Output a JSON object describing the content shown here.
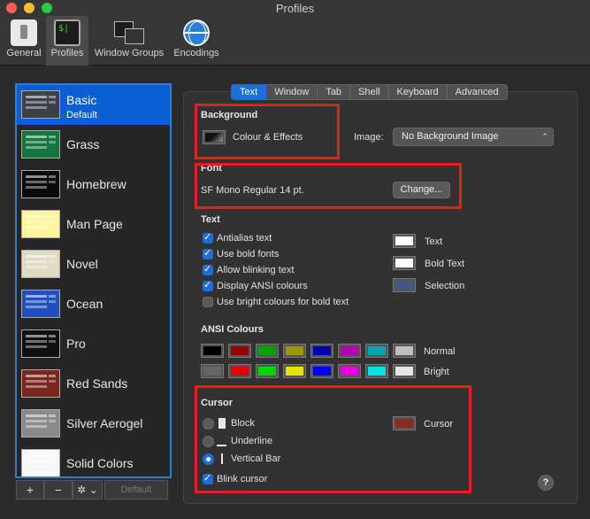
{
  "window": {
    "title": "Profiles"
  },
  "toolbar": {
    "items": [
      {
        "label": "General"
      },
      {
        "label": "Profiles"
      },
      {
        "label": "Window Groups"
      },
      {
        "label": "Encodings"
      }
    ]
  },
  "sidebar": {
    "profiles": [
      {
        "name": "Basic",
        "subtitle": "Default",
        "bg": "#3d3f4a",
        "accent": "#c8c8d0"
      },
      {
        "name": "Grass",
        "bg": "#13773d",
        "accent": "#f7f0a0"
      },
      {
        "name": "Homebrew",
        "bg": "#0a0a0a",
        "accent": "#28fe14"
      },
      {
        "name": "Man Page",
        "bg": "#fef49c",
        "accent": "#333333"
      },
      {
        "name": "Novel",
        "bg": "#dfdbc3",
        "accent": "#3b2322"
      },
      {
        "name": "Ocean",
        "bg": "#224fbc",
        "accent": "#ffffff"
      },
      {
        "name": "Pro",
        "bg": "#101010",
        "accent": "#f2f2f2"
      },
      {
        "name": "Red Sands",
        "bg": "#7a251e",
        "accent": "#d7c9a7"
      },
      {
        "name": "Silver Aerogel",
        "bg": "#8a8a8a",
        "accent": "#111111"
      },
      {
        "name": "Solid Colors",
        "bg": "#f7f7f7",
        "accent": "#c01e2a"
      }
    ],
    "footer": {
      "add": "+",
      "remove": "−",
      "gear": "✲ ⌄",
      "default_label": "Default"
    }
  },
  "tabs": [
    {
      "label": "Text"
    },
    {
      "label": "Window"
    },
    {
      "label": "Tab"
    },
    {
      "label": "Shell"
    },
    {
      "label": "Keyboard"
    },
    {
      "label": "Advanced"
    }
  ],
  "background": {
    "title": "Background",
    "colour_effects_label": "Colour & Effects",
    "image_label": "Image:",
    "image_value": "No Background Image"
  },
  "font": {
    "title": "Font",
    "value": "SF Mono Regular 14 pt.",
    "change_button": "Change..."
  },
  "text": {
    "title": "Text",
    "options": [
      {
        "label": "Antialias text",
        "checked": true
      },
      {
        "label": "Use bold fonts",
        "checked": true
      },
      {
        "label": "Allow blinking text",
        "checked": true
      },
      {
        "label": "Display ANSI colours",
        "checked": true
      },
      {
        "label": "Use bright colours for bold text",
        "checked": false
      }
    ],
    "colours": [
      {
        "label": "Text",
        "color": "#ffffff"
      },
      {
        "label": "Bold Text",
        "color": "#ffffff"
      },
      {
        "label": "Selection",
        "color": "#3e5a85"
      }
    ]
  },
  "ansi": {
    "title": "ANSI Colours",
    "normal_label": "Normal",
    "bright_label": "Bright",
    "normal": [
      "#000000",
      "#990000",
      "#00a600",
      "#999900",
      "#0000b2",
      "#b200b2",
      "#00a6b2",
      "#bfbfbf"
    ],
    "bright": [
      "#666666",
      "#e50000",
      "#00d900",
      "#e5e500",
      "#0000ff",
      "#e500e5",
      "#00e5e5",
      "#e5e5e5"
    ]
  },
  "cursor": {
    "title": "Cursor",
    "options": [
      {
        "label": "Block",
        "selected": false
      },
      {
        "label": "Underline",
        "selected": false
      },
      {
        "label": "Vertical Bar",
        "selected": true
      }
    ],
    "blink_label": "Blink cursor",
    "blink_checked": true,
    "colour_label": "Cursor",
    "colour": "#8e2a22"
  },
  "help_label": "?"
}
